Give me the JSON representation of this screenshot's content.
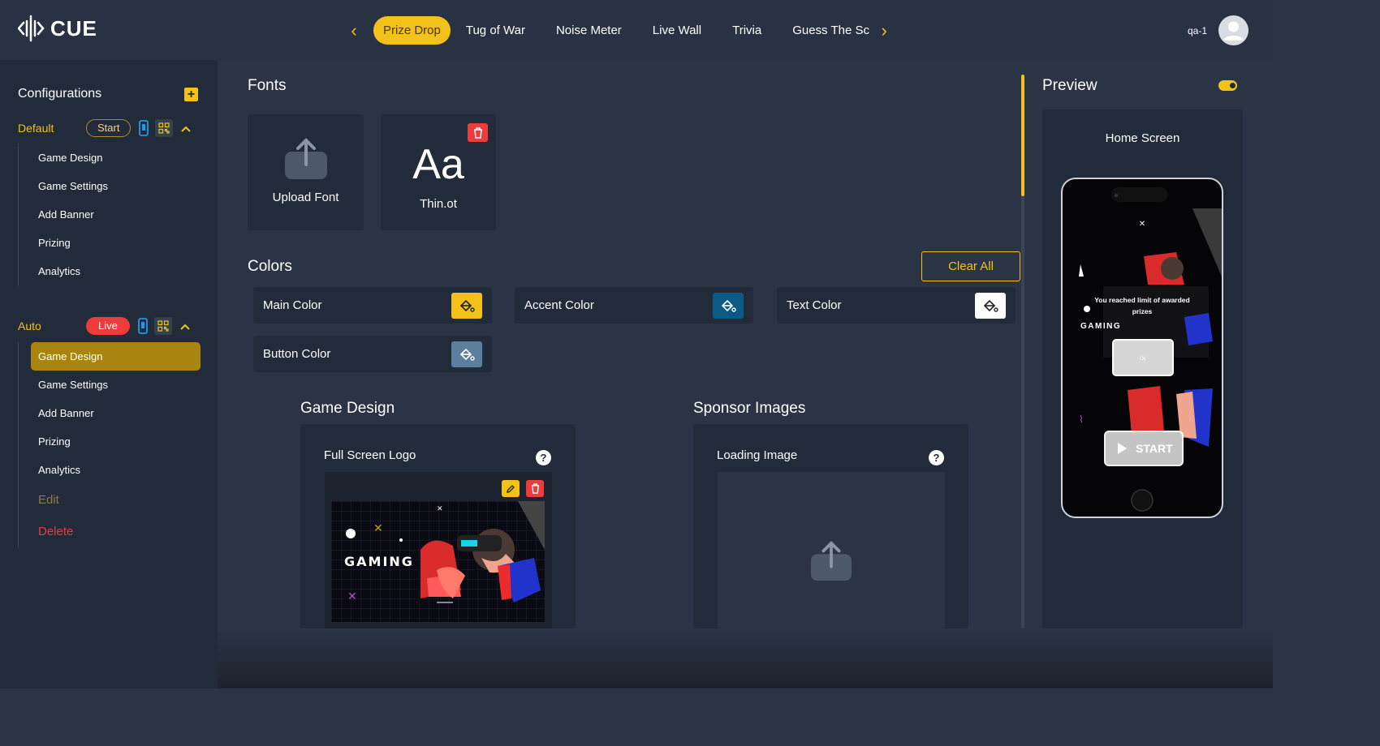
{
  "app": {
    "logo_text": "CUE"
  },
  "nav": {
    "tabs": [
      "Prize Drop",
      "Tug of War",
      "Noise Meter",
      "Live Wall",
      "Trivia",
      "Guess The Sc"
    ],
    "active_index": 0
  },
  "user": {
    "name": "qa-1"
  },
  "sidebar": {
    "title": "Configurations",
    "groups": [
      {
        "name": "Default",
        "status": "Start",
        "items": [
          "Game Design",
          "Game Settings",
          "Add Banner",
          "Prizing",
          "Analytics"
        ]
      },
      {
        "name": "Auto",
        "status": "Live",
        "items": [
          "Game Design",
          "Game Settings",
          "Add Banner",
          "Prizing",
          "Analytics"
        ],
        "active_item": "Game Design",
        "edit_label": "Edit",
        "delete_label": "Delete"
      }
    ]
  },
  "fonts": {
    "title": "Fonts",
    "upload_label": "Upload Font",
    "font_sample": "Aa",
    "font_name": "Thin.ot"
  },
  "colors": {
    "title": "Colors",
    "clear_all": "Clear All",
    "items": [
      {
        "label": "Main Color",
        "value": "#f2c21b"
      },
      {
        "label": "Accent Color",
        "value": "#0b5a86"
      },
      {
        "label": "Text Color",
        "value": "#ffffff"
      },
      {
        "label": "Button Color",
        "value": "#5b7f9c"
      }
    ]
  },
  "game_design": {
    "title": "Game Design",
    "card_label": "Full Screen Logo",
    "logo_text": "GAMING"
  },
  "sponsor": {
    "title": "Sponsor Images",
    "card_label": "Loading Image"
  },
  "preview": {
    "title": "Preview",
    "screen_title": "Home Screen",
    "message": "You reached limit of awarded prizes",
    "ok_label": "Ok",
    "start_label": "START",
    "logo_text": "GAMING"
  }
}
